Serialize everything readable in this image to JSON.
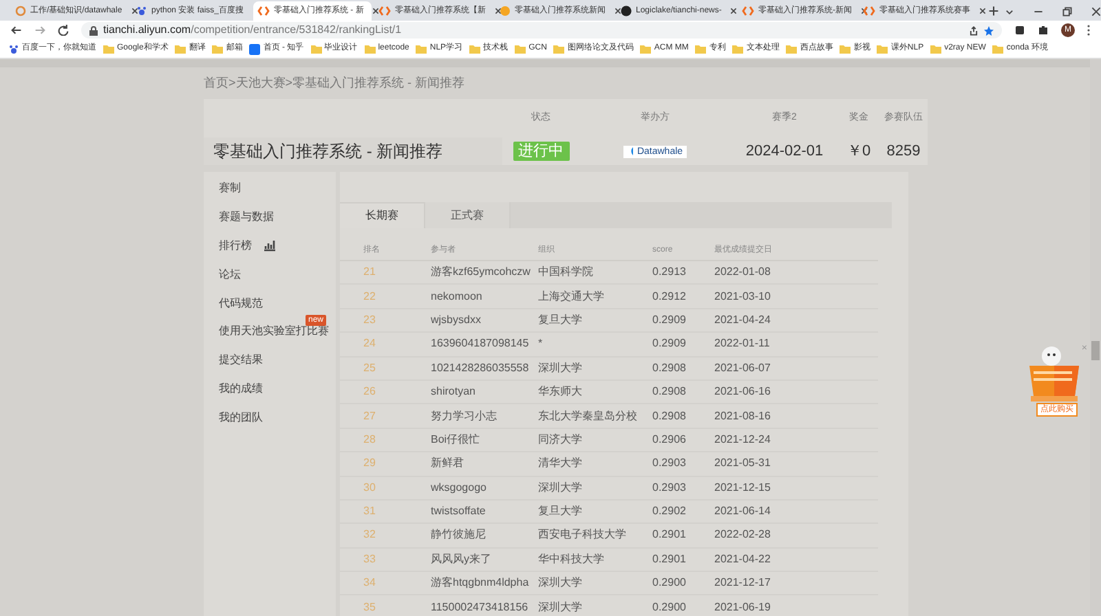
{
  "browser": {
    "tabs": [
      {
        "title": "工作/基础知识/datawhale",
        "selected": false
      },
      {
        "title": "python 安装 faiss_百度搜",
        "selected": false
      },
      {
        "title": "零基础入门推荐系统 - 新",
        "selected": true
      },
      {
        "title": "零基础入门推荐系统【新",
        "selected": false
      },
      {
        "title": "零基础入门推荐系统新闻",
        "selected": false
      },
      {
        "title": "Logiclake/tianchi-news-",
        "selected": false
      },
      {
        "title": "零基础入门推荐系统-新闻",
        "selected": false
      },
      {
        "title": "零基础入门推荐系统赛事",
        "selected": false
      }
    ],
    "url_host": "tianchi.aliyun.com",
    "url_path": "/competition/entrance/531842/rankingList/1",
    "avatar": "M",
    "bookmarks": [
      "百度一下，你就知道",
      "Google和学术",
      "翻译",
      "邮箱",
      "首页 - 知乎",
      "毕业设计",
      "leetcode",
      "NLP学习",
      "技术栈",
      "GCN",
      "图网络论文及代码",
      "ACM MM",
      "专利",
      "文本处理",
      "西点故事",
      "影视",
      "课外NLP",
      "v2ray NEW",
      "conda 环境"
    ]
  },
  "breadcrumb": "首页>天池大赛>零基础入门推荐系统 - 新闻推荐",
  "header": {
    "title": "零基础入门推荐系统 - 新闻推荐",
    "labels": [
      "状态",
      "举办方",
      "赛季2",
      "奖金",
      "参赛队伍"
    ],
    "status": {
      "label": "进行中",
      "kind": "active"
    },
    "organizer": "Datawhale",
    "season": "2024-02-01",
    "prize": "￥0",
    "teams": "8259"
  },
  "sidebar": [
    {
      "label": "赛制",
      "kind": "plain"
    },
    {
      "label": "赛题与数据",
      "kind": "plain"
    },
    {
      "label": "排行榜",
      "kind": "chart"
    },
    {
      "label": "论坛",
      "kind": "plain"
    },
    {
      "label": "代码规范",
      "kind": "plain"
    },
    {
      "label": "使用天池实验室打比赛",
      "kind": "badge",
      "badge": "new"
    },
    {
      "label": "提交结果",
      "kind": "plain"
    },
    {
      "label": "我的成绩",
      "kind": "plain"
    },
    {
      "label": "我的团队",
      "kind": "plain"
    }
  ],
  "board_tabs": [
    {
      "label": "长期赛",
      "selected": true
    },
    {
      "label": "正式赛",
      "selected": false
    }
  ],
  "table": {
    "columns": [
      "排名",
      "参与者",
      "组织",
      "score",
      "最优成绩提交日"
    ],
    "rows": [
      [
        "21",
        "游客kzf65ymcohczw",
        "中国科学院",
        "0.2913",
        "2022-01-08"
      ],
      [
        "22",
        "nekomoon",
        "上海交通大学",
        "0.2912",
        "2021-03-10"
      ],
      [
        "23",
        "wjsbysdxx",
        "复旦大学",
        "0.2909",
        "2021-04-24"
      ],
      [
        "24",
        "1639604187098145",
        "*",
        "0.2909",
        "2022-01-11"
      ],
      [
        "25",
        "1021428286035558",
        "深圳大学",
        "0.2908",
        "2021-06-07"
      ],
      [
        "26",
        "shirotyan",
        "华东师大",
        "0.2908",
        "2021-06-16"
      ],
      [
        "27",
        "努力学习小志",
        "东北大学秦皇岛分校",
        "0.2908",
        "2021-08-16"
      ],
      [
        "28",
        "Boi仔很忙",
        "同济大学",
        "0.2906",
        "2021-12-24"
      ],
      [
        "29",
        "新鲜君",
        "清华大学",
        "0.2903",
        "2021-05-31"
      ],
      [
        "30",
        "wksgogogo",
        "深圳大学",
        "0.2903",
        "2021-12-15"
      ],
      [
        "31",
        "twistsoffate",
        "复旦大学",
        "0.2902",
        "2021-06-14"
      ],
      [
        "32",
        "静竹彼施尼",
        "西安电子科技大学",
        "0.2901",
        "2022-02-28"
      ],
      [
        "33",
        "风风风y来了",
        "华中科技大学",
        "0.2901",
        "2021-04-22"
      ],
      [
        "34",
        "游客htqgbnm4ldpha",
        "深圳大学",
        "0.2900",
        "2021-12-17"
      ],
      [
        "35",
        "1150002473418156",
        "深圳大学",
        "0.2900",
        "2021-06-19"
      ]
    ]
  },
  "promo": {
    "button": "点此购买",
    "close": "×"
  }
}
